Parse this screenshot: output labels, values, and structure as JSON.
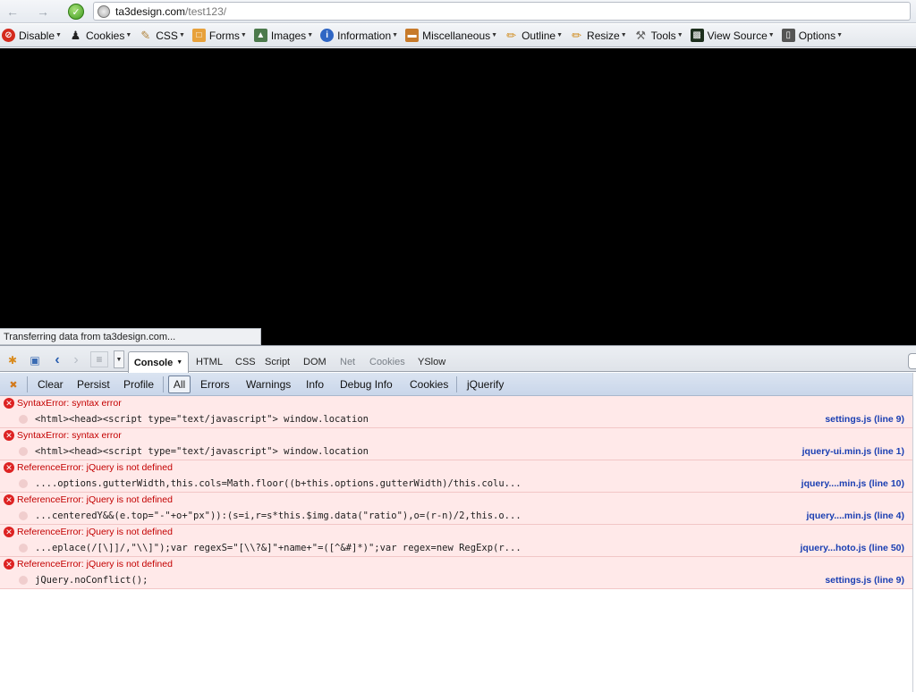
{
  "navbar": {
    "url_host": "ta3design.com",
    "url_path": "/test123/"
  },
  "devbar": {
    "items": [
      {
        "label": "Disable",
        "icon": "disable-icon"
      },
      {
        "label": "Cookies",
        "icon": "cookies-icon"
      },
      {
        "label": "CSS",
        "icon": "css-icon"
      },
      {
        "label": "Forms",
        "icon": "forms-icon"
      },
      {
        "label": "Images",
        "icon": "images-icon"
      },
      {
        "label": "Information",
        "icon": "info-icon"
      },
      {
        "label": "Miscellaneous",
        "icon": "misc-icon"
      },
      {
        "label": "Outline",
        "icon": "outline-icon"
      },
      {
        "label": "Resize",
        "icon": "resize-icon"
      },
      {
        "label": "Tools",
        "icon": "tools-icon"
      },
      {
        "label": "View Source",
        "icon": "view-source-icon"
      },
      {
        "label": "Options",
        "icon": "options-icon"
      }
    ]
  },
  "status": {
    "text": "Transferring data from ta3design.com..."
  },
  "firebug": {
    "active_tab": "Console",
    "tabs": [
      "HTML",
      "CSS",
      "Script",
      "DOM",
      "Net",
      "Cookies",
      "YSlow"
    ],
    "filters": {
      "clear": "Clear",
      "persist": "Persist",
      "profile": "Profile",
      "all": "All",
      "errors": "Errors",
      "warnings": "Warnings",
      "info": "Info",
      "debug_info": "Debug Info",
      "cookies": "Cookies",
      "jquerify": "jQuerify"
    }
  },
  "log": [
    {
      "message": "SyntaxError: syntax error",
      "code": "<html><head><script type=\"text/javascript\"> window.location",
      "source": "settings.js (line 9)"
    },
    {
      "message": "SyntaxError: syntax error",
      "code": "<html><head><script type=\"text/javascript\"> window.location",
      "source": "jquery-ui.min.js (line 1)"
    },
    {
      "message": "ReferenceError: jQuery is not defined",
      "code": "....options.gutterWidth,this.cols=Math.floor((b+this.options.gutterWidth)/this.colu...",
      "source": "jquery....min.js (line 10)"
    },
    {
      "message": "ReferenceError: jQuery is not defined",
      "code": "...centeredY&&(e.top=\"-\"+o+\"px\")):(s=i,r=s*this.$img.data(\"ratio\"),o=(r-n)/2,this.o...",
      "source": "jquery....min.js (line 4)"
    },
    {
      "message": "ReferenceError: jQuery is not defined",
      "code": "...eplace(/[\\]]/,\"\\\\]\");var regexS=\"[\\\\?&]\"+name+\"=([^&#]*)\";var regex=new RegExp(r...",
      "source": "jquery...hoto.js (line 50)"
    },
    {
      "message": "ReferenceError: jQuery is not defined",
      "code": "jQuery.noConflict();",
      "source": "settings.js (line 9)"
    }
  ]
}
